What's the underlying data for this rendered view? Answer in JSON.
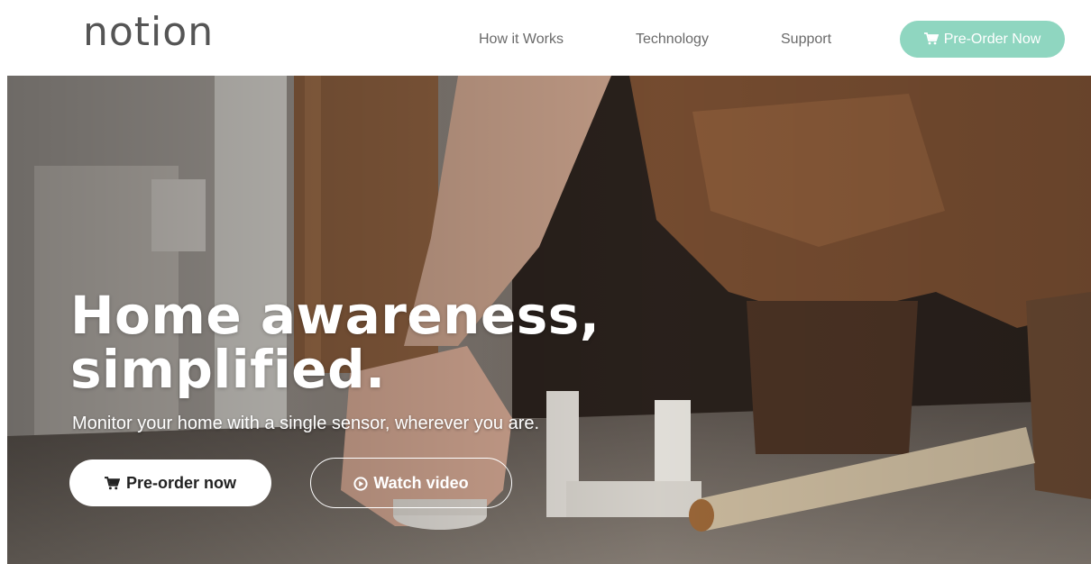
{
  "header": {
    "logo": "notion",
    "nav": [
      {
        "label": "How it Works"
      },
      {
        "label": "Technology"
      },
      {
        "label": "Support"
      }
    ],
    "cta_label": "Pre-Order Now"
  },
  "hero": {
    "title_line1": "Home awareness,",
    "title_line2": "simplified.",
    "subtitle": "Monitor your home with a single sensor, wherever you are.",
    "primary_label": "Pre-order now",
    "secondary_label": "Watch video"
  },
  "icons": {
    "cart": "cart-icon",
    "play": "play-circle-icon"
  },
  "colors": {
    "accent": "#8fd6c0",
    "nav_text": "#6a6a6a",
    "logo_text": "#555555"
  }
}
